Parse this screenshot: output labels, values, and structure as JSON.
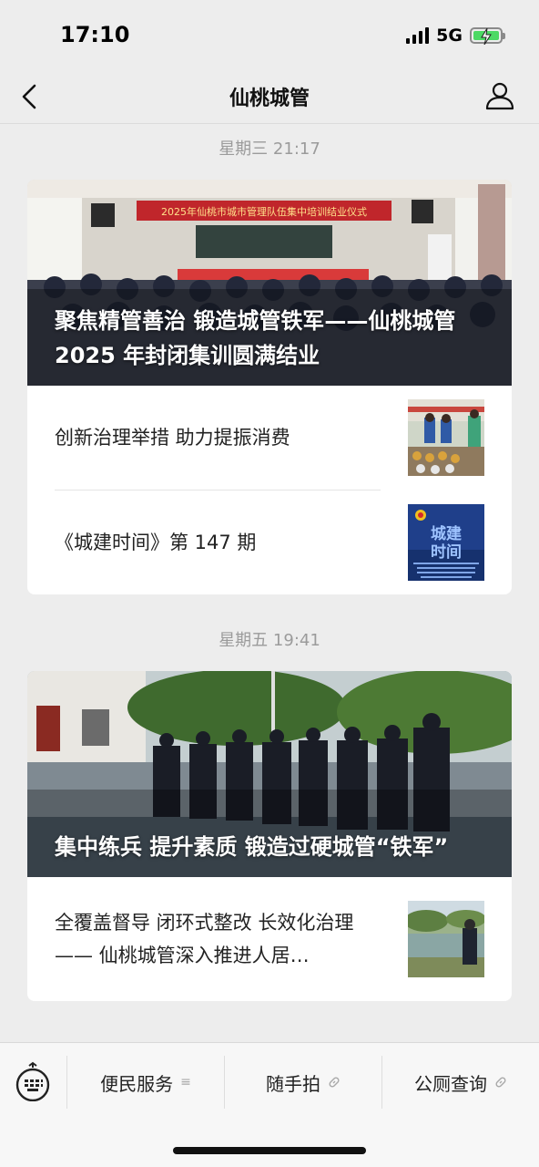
{
  "status": {
    "time": "17:10",
    "network": "5G",
    "battery_percent": 100
  },
  "nav": {
    "title": "仙桃城管",
    "back_icon": "chevron-left-icon",
    "profile_icon": "person-icon"
  },
  "groups": [
    {
      "timestamp": "星期三 21:17",
      "hero": {
        "title": "聚焦精管善治 锻造城管铁军——仙桃城管 2025 年封闭集训圆满结业",
        "banner": "2025年仙桃市城市管理队伍集中培训结业仪式"
      },
      "items": [
        {
          "title": "创新治理举措  助力提振消费"
        },
        {
          "title": "《城建时间》第 147 期",
          "thumb_text": "城建时间"
        }
      ]
    },
    {
      "timestamp": "星期五 19:41",
      "hero": {
        "title": "集中练兵 提升素质 锻造过硬城管“铁军”"
      },
      "items": [
        {
          "title": "全覆盖督导 闭环式整改 长效化治理—— 仙桃城管深入推进人居…"
        }
      ]
    }
  ],
  "menu": {
    "keyboard_icon": "keyboard-icon",
    "items": [
      {
        "label": "便民服务",
        "icon": "menu-lines-icon"
      },
      {
        "label": "随手拍",
        "icon": "link-icon"
      },
      {
        "label": "公厕查询",
        "icon": "link-icon"
      }
    ]
  },
  "colors": {
    "background": "#ededed",
    "card": "#ffffff",
    "timestamp": "#9b9b9b",
    "banner_red": "#c0262b"
  }
}
